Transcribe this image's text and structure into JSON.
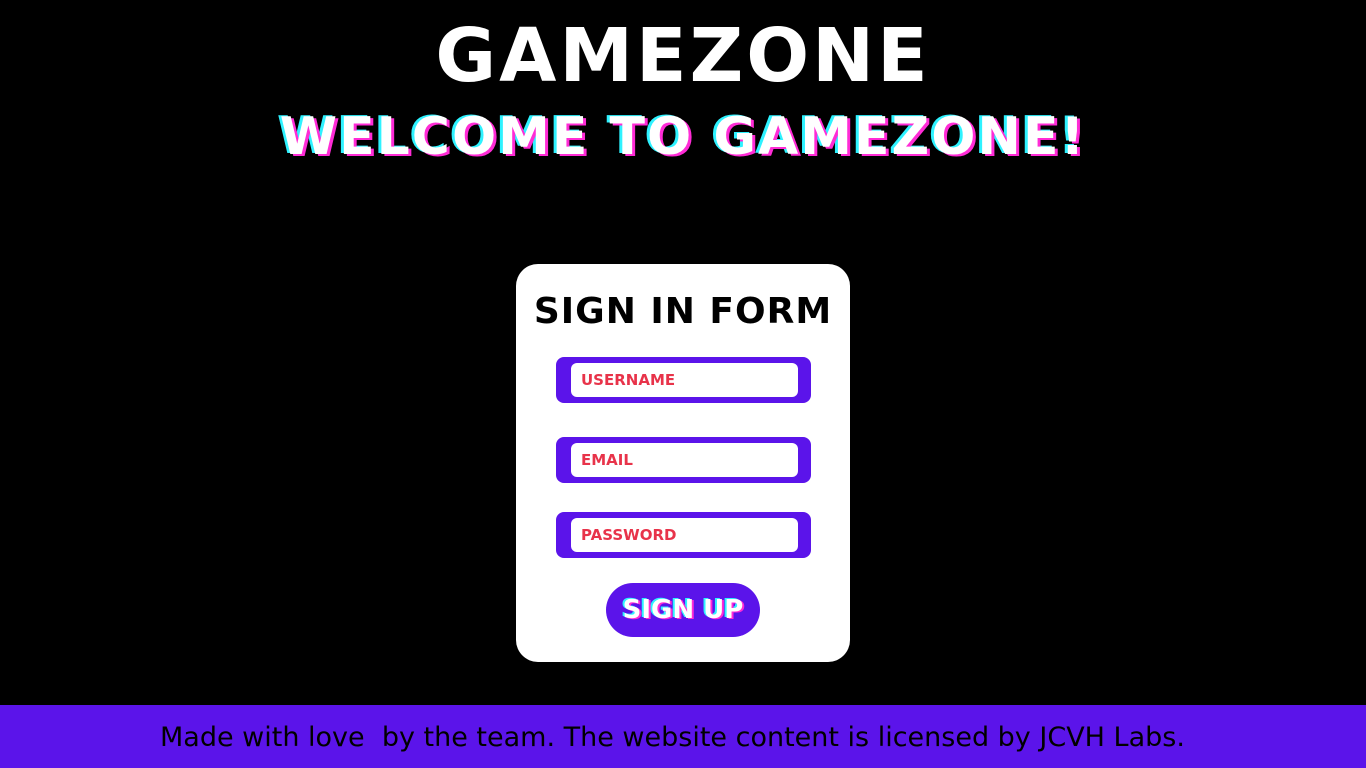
{
  "header": {
    "site_title": "GAMEZONE",
    "welcome": "WELCOME TO GAMEZONE!"
  },
  "form": {
    "title": "SIGN IN FORM",
    "username": {
      "placeholder": "USERNAME",
      "value": ""
    },
    "email": {
      "placeholder": "EMAIL",
      "value": ""
    },
    "password": {
      "placeholder": "PASSWORD",
      "value": ""
    },
    "submit_label": "SIGN UP"
  },
  "footer": {
    "text": "Made with love  by the team. The website content is licensed by JCVH Labs."
  },
  "colors": {
    "background": "#000000",
    "accent": "#5b14ea",
    "card": "#ffffff",
    "placeholder": "#e8334a",
    "glow_pink": "#ff2bd6",
    "glow_cyan": "#2ef2ff"
  }
}
